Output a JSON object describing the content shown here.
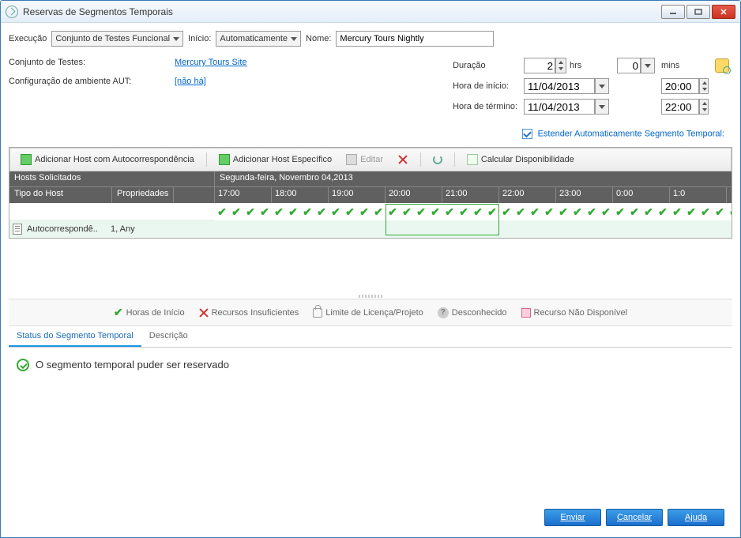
{
  "window": {
    "title": "Reservas de Segmentos Temporais"
  },
  "row1": {
    "exec_label": "Execução",
    "exec_value": "Conjunto de Testes Funcional",
    "start_label": "Início:",
    "start_value": "Automaticamente",
    "name_label": "Nome:",
    "name_value": "Mercury Tours Nightly"
  },
  "left_info": {
    "testset_label": "Conjunto de Testes:",
    "testset_link": "Mercury Tours Site",
    "env_label": "Configuração de ambiente AUT:",
    "env_link": "[não há]"
  },
  "right_info": {
    "duration_label": "Duração",
    "duration_hrs": "2",
    "hrs_label": "hrs",
    "duration_mins": "0",
    "mins_label": "mins",
    "start_time_label": "Hora de início:",
    "start_date": "11/04/2013",
    "start_time": "20:00",
    "end_time_label": "Hora de término:",
    "end_date": "11/04/2013",
    "end_time": "22:00"
  },
  "extend": {
    "label": "Estender Automaticamente Segmento Temporal:"
  },
  "toolbar": {
    "add_auto": "Adicionar Host com Autocorrespondência",
    "add_specific": "Adicionar Host Específico",
    "edit": "Editar",
    "calc": "Calcular Disponibilidade"
  },
  "grid": {
    "hosts_label": "Hosts Solicitados",
    "date_label": "Segunda-feira, Novembro 04,2013",
    "col_hosttype": "Tipo do Host",
    "col_props": "Propriedades",
    "hours": [
      "17:00",
      "18:00",
      "19:00",
      "20:00",
      "21:00",
      "22:00",
      "23:00",
      "0:00",
      "1:0"
    ],
    "host_row": {
      "type": "Autocorrespondê..",
      "props": "1, Any"
    }
  },
  "legend": {
    "start": "Horas de Início",
    "insuf": "Recursos Insuficientes",
    "limit": "Limite de Licença/Projeto",
    "unknown": "Desconhecido",
    "unavail": "Recurso Não Disponível"
  },
  "tabs": {
    "status": "Status do Segmento Temporal",
    "desc": "Descrição"
  },
  "status": {
    "message": "O segmento temporal puder ser reservado"
  },
  "footer": {
    "submit": "Enviar",
    "cancel": "Cancelar",
    "help": "Ajuda"
  }
}
